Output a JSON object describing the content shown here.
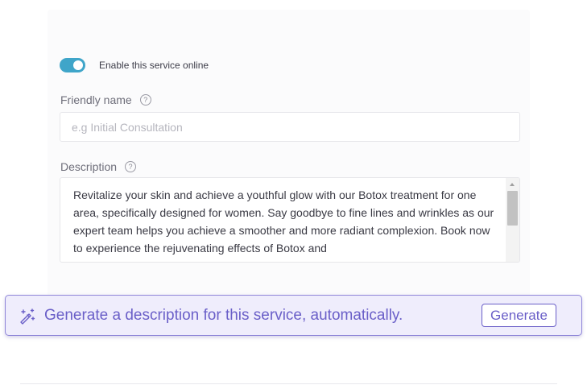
{
  "service_form": {
    "enable_online": {
      "label": "Enable this service online",
      "enabled": true
    },
    "friendly_name": {
      "label": "Friendly name",
      "help_icon": "question-circle-icon",
      "value": "",
      "placeholder": "e.g Initial Consultation"
    },
    "description": {
      "label": "Description",
      "help_icon": "question-circle-icon",
      "value": "Revitalize your skin and achieve a youthful glow with our Botox treatment for one area, specifically designed for women. Say goodbye to fine lines and wrinkles as our expert team helps you achieve a smoother and more radiant complexion. Book now to experience the rejuvenating effects of Botox and"
    }
  },
  "ai_banner": {
    "icon": "magic-wand-icon",
    "text": "Generate a description for this service, automatically.",
    "button_label": "Generate"
  },
  "colors": {
    "toggle_on": "#3fa5c9",
    "ai_accent": "#6a5fc8",
    "ai_background": "#efedfc"
  }
}
